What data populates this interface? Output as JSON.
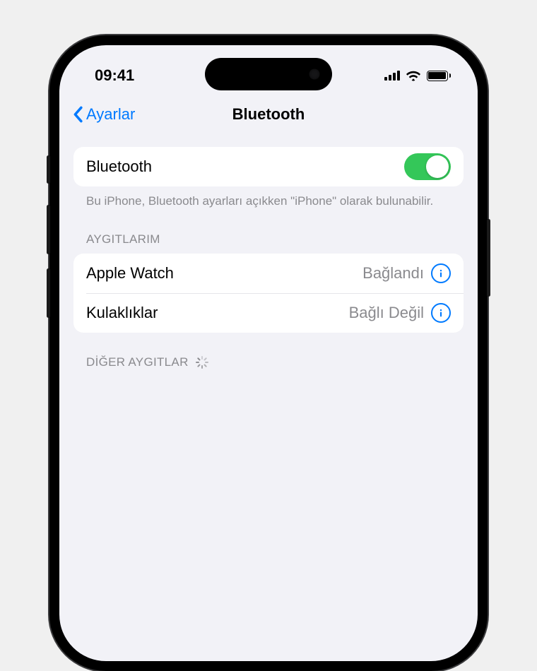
{
  "status": {
    "time": "09:41"
  },
  "nav": {
    "back": "Ayarlar",
    "title": "Bluetooth"
  },
  "toggle": {
    "label": "Bluetooth",
    "on": true
  },
  "note": "Bu iPhone, Bluetooth ayarları açıkken \"iPhone\" olarak bulunabilir.",
  "sections": {
    "my_devices": {
      "header": "AYGITLARIM",
      "items": [
        {
          "name": "Apple Watch",
          "status": "Bağlandı"
        },
        {
          "name": "Kulaklıklar",
          "status": "Bağlı Değil"
        }
      ]
    },
    "other_devices": {
      "header": "DİĞER AYGITLAR"
    }
  },
  "colors": {
    "accent": "#007aff",
    "toggle_on": "#34c759",
    "secondary": "#8a8a8e",
    "bg": "#f2f2f7"
  }
}
